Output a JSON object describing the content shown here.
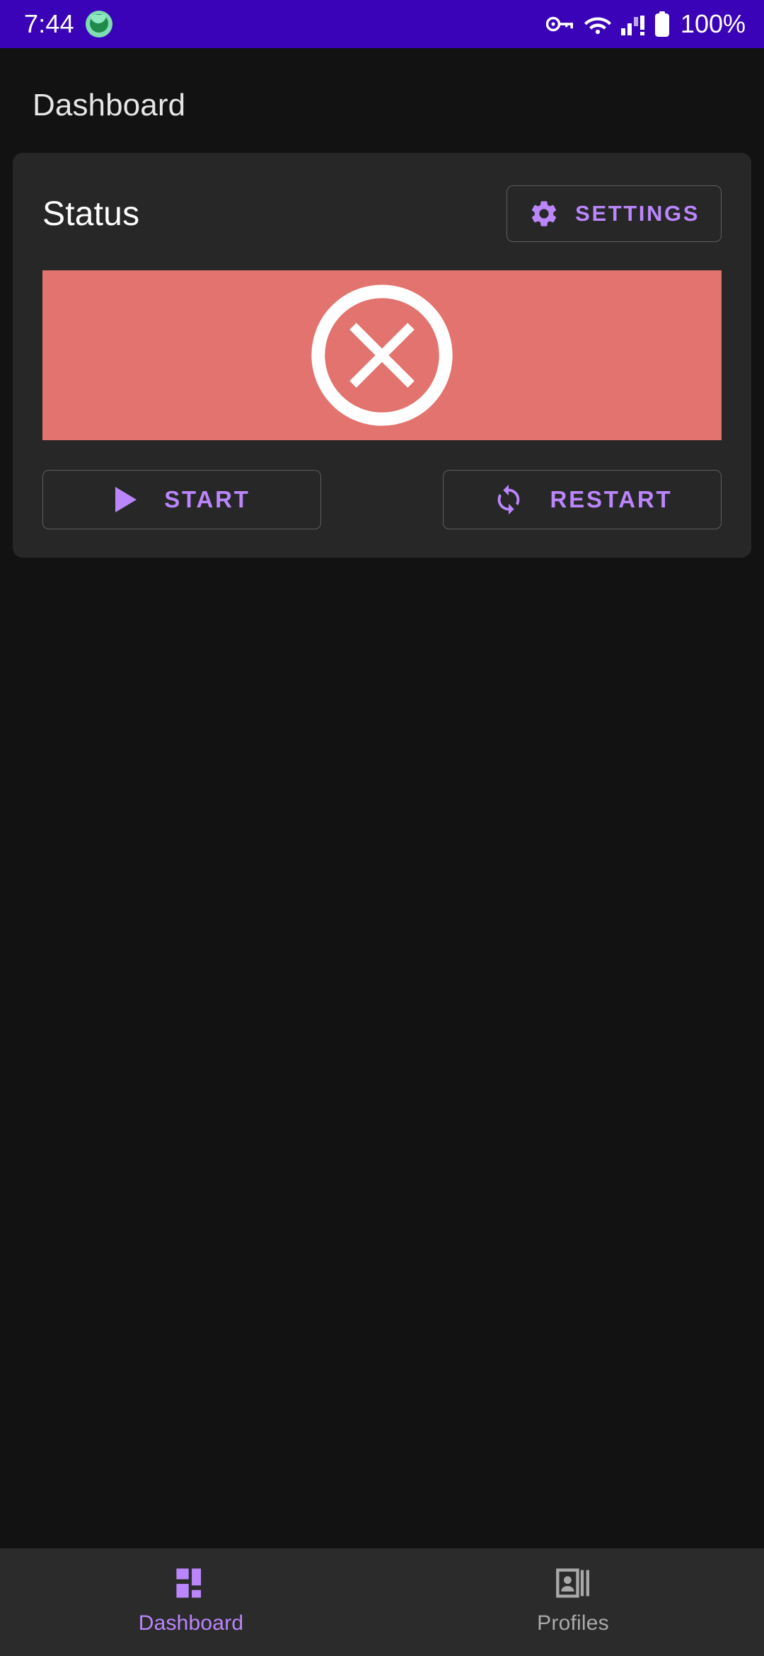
{
  "status_bar": {
    "clock": "7:44",
    "app_badge_icon": "green-app-icon",
    "icons": [
      "vpn-key-icon",
      "wifi-icon",
      "cellular-signal-alert-icon",
      "battery-full-icon"
    ],
    "battery_percent": "100%",
    "background_color": "#3A03B8"
  },
  "header": {
    "title": "Dashboard"
  },
  "card": {
    "title": "Status",
    "settings": {
      "label": "SETTINGS",
      "icon": "gear-icon"
    },
    "banner": {
      "state_icon": "error-circle-x-icon",
      "color": "#E2736E",
      "icon_color": "#FFFFFF"
    },
    "actions": [
      {
        "label": "START",
        "icon": "play-icon"
      },
      {
        "label": "RESTART",
        "icon": "refresh-icon"
      }
    ]
  },
  "bottom_nav": {
    "items": [
      {
        "label": "Dashboard",
        "icon": "dashboard-grid-icon",
        "active": true
      },
      {
        "label": "Profiles",
        "icon": "contact-card-icon",
        "active": false
      }
    ]
  },
  "colors": {
    "accent": "#BB86FC",
    "page_background": "#121212",
    "card_background": "#272727",
    "nav_background": "#2B2B2B",
    "error": "#E2736E"
  }
}
